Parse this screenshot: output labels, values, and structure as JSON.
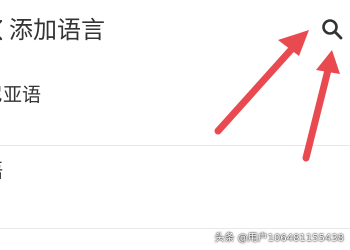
{
  "app_bar": {
    "title": "添加语言",
    "back_icon": "back-arrow-icon",
    "search_icon": "search-icon"
  },
  "languages": {
    "items": [
      {
        "label": "尼亚语"
      },
      {
        "label": "语"
      }
    ]
  },
  "annotation": {
    "arrow_color": "#e84a50"
  },
  "watermark": {
    "text": "头条 @用户10648115543​8"
  }
}
